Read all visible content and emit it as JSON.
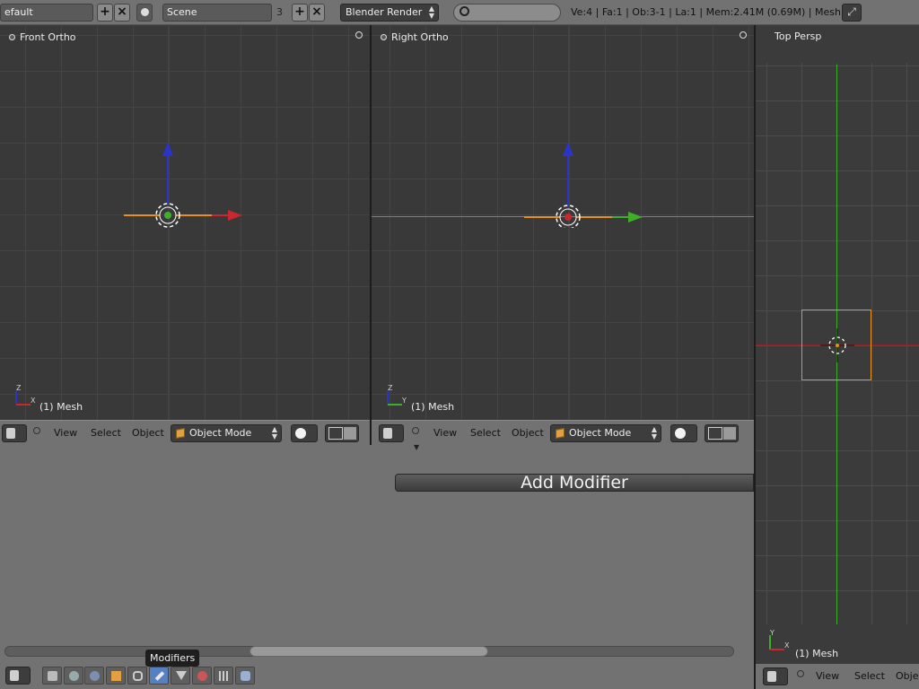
{
  "top_bar": {
    "screen_layout": "efault",
    "scene_name": "Scene",
    "scene_users": "3",
    "render_engine": "Blender Render",
    "stats": "Ve:4 | Fa:1 | Ob:3-1 | La:1 | Mem:2.41M (0.69M) | Mesh"
  },
  "viewports": [
    {
      "name": "Front Ortho",
      "mesh": "(1) Mesh",
      "axis_a": "Z",
      "axis_b": "X"
    },
    {
      "name": "Right Ortho",
      "mesh": "(1) Mesh",
      "axis_a": "Z",
      "axis_b": "Y"
    },
    {
      "name": "Top Persp",
      "mesh": "(1) Mesh",
      "axis_a": "Y",
      "axis_b": "X"
    }
  ],
  "view_header": {
    "view": "View",
    "select": "Select",
    "object": "Object",
    "object_truncated": "Objec",
    "mode": "Object Mode"
  },
  "properties": {
    "add_modifier": "Add Modifier",
    "tooltip": "Modifiers"
  },
  "colors": {
    "x_axis": "#c8282e",
    "y_axis": "#3fae2a",
    "z_axis": "#2a35c8",
    "selection": "#e6901e",
    "active_tab": "#5680c2"
  }
}
